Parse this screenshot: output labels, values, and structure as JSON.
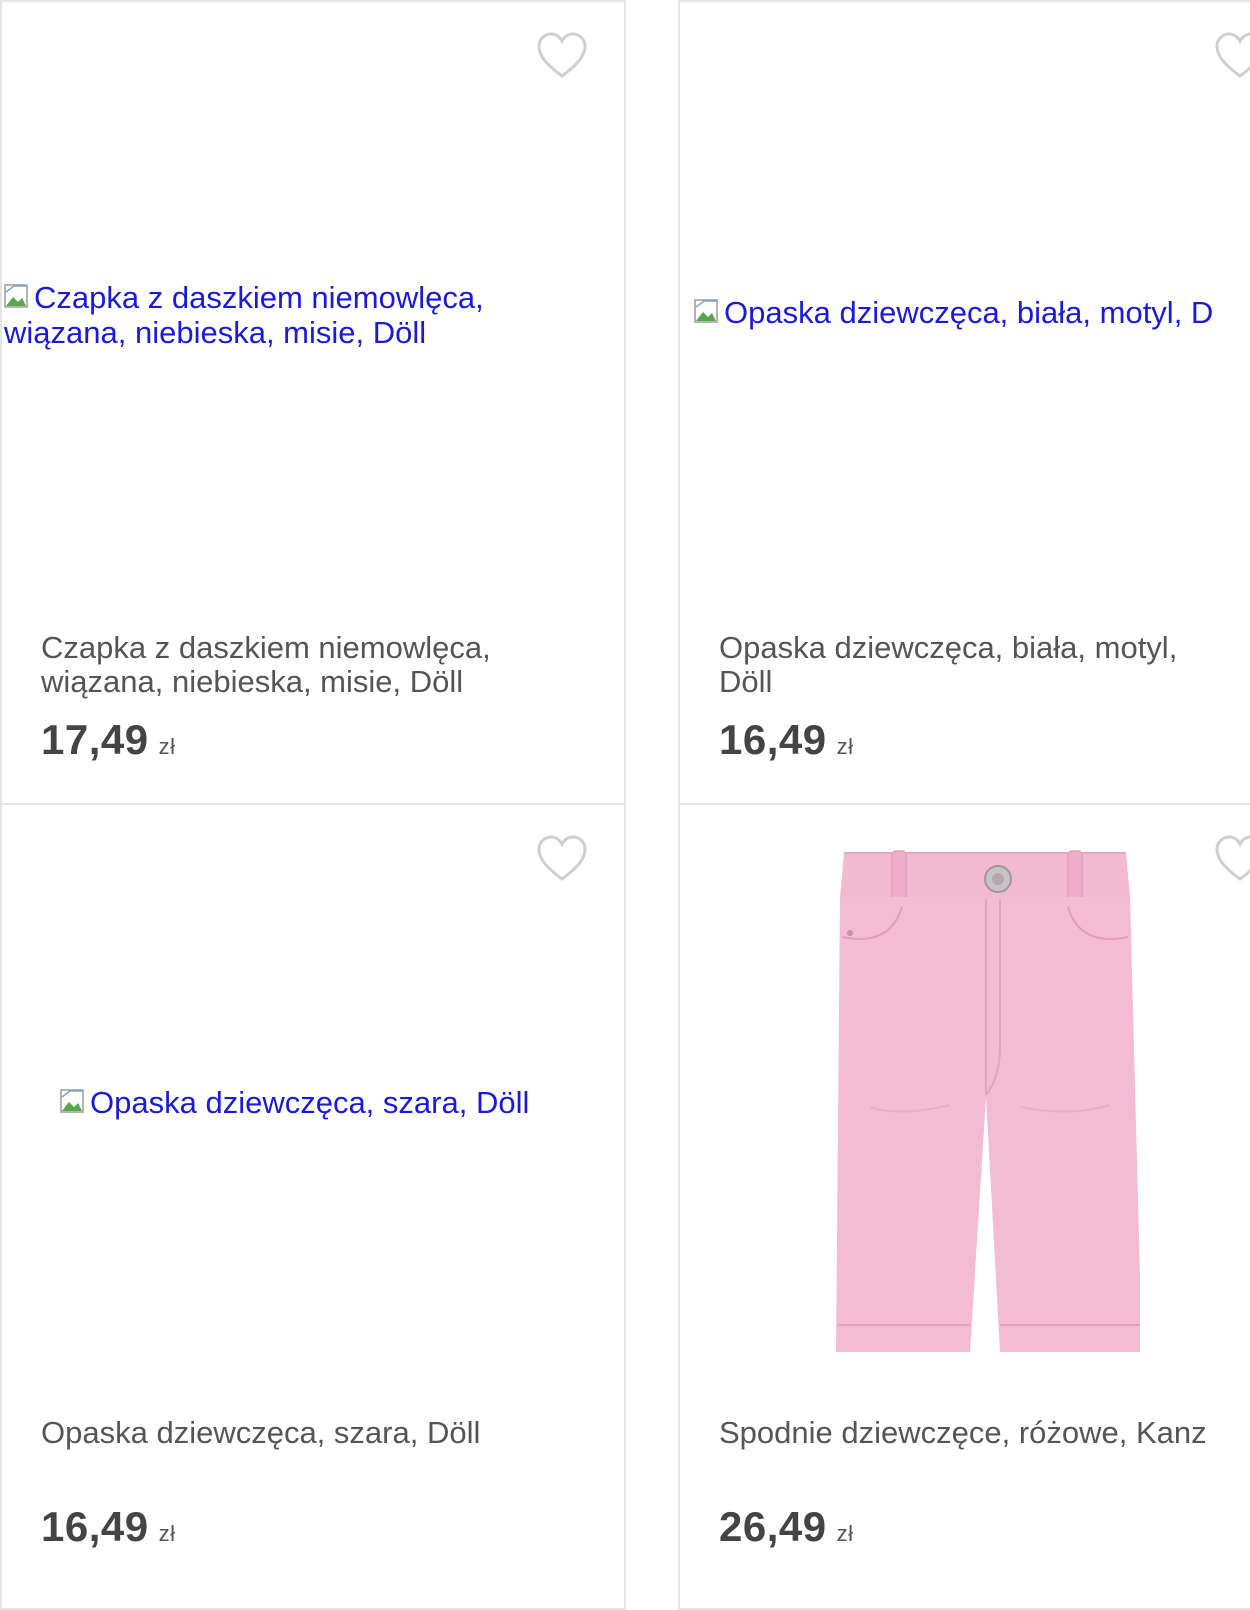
{
  "products": [
    {
      "title": "Czapka z daszkiem niemowlęca, wiązana, niebieska, misie, Döll",
      "image_alt": "Czapka z daszkiem niemowlęca, wiązana, niebieska, misie, Döll",
      "price": "17,49",
      "currency": "zł",
      "image_state": "broken"
    },
    {
      "title": "Opaska dziewczęca, biała, motyl, Döll",
      "image_alt": "Opaska dziewczęca, biała, motyl, D",
      "price": "16,49",
      "currency": "zł",
      "image_state": "broken"
    },
    {
      "title": "Opaska dziewczęca, szara, Döll",
      "image_alt": "Opaska dziewczęca, szara, Döll",
      "price": "16,49",
      "currency": "zł",
      "image_state": "broken"
    },
    {
      "title": "Spodnie dziewczęce, różowe, Kanz",
      "price": "26,49",
      "currency": "zł",
      "image_state": "pink-pants-photo"
    }
  ],
  "icons": {
    "favorite": "heart-outline-icon",
    "broken_image": "broken-image-icon"
  },
  "colors": {
    "alt_text": "#1a1adb",
    "title_text": "#555555",
    "price_text": "#444444",
    "card_border": "#e5e5e5",
    "heart": "#d0d0d0",
    "pants": "#f2b8cf"
  }
}
